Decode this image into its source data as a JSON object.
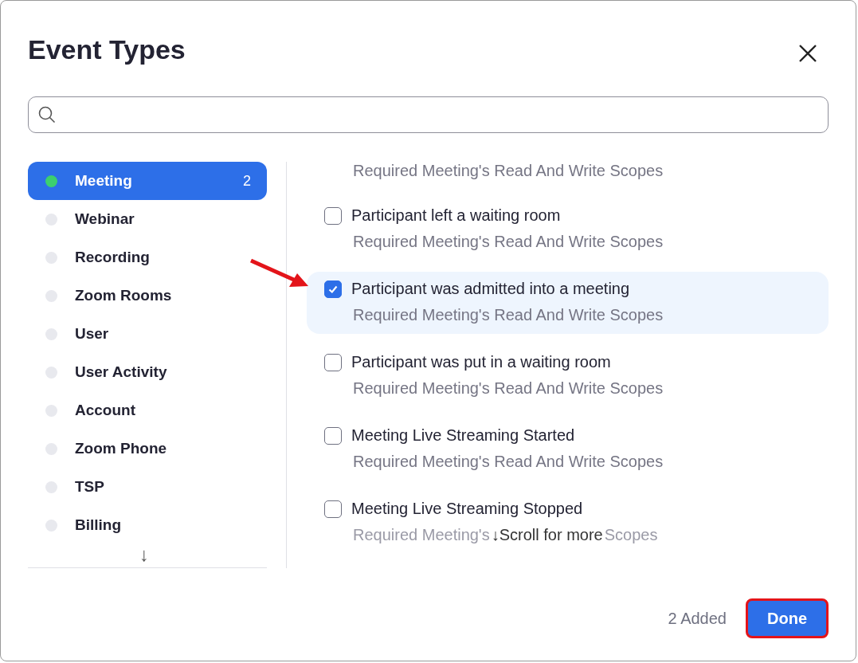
{
  "dialog": {
    "title": "Event Types"
  },
  "sidebar": {
    "items": [
      {
        "label": "Meeting",
        "selected": true,
        "count": "2",
        "color": "#3ccf6e"
      },
      {
        "label": "Webinar",
        "selected": false
      },
      {
        "label": "Recording",
        "selected": false
      },
      {
        "label": "Zoom Rooms",
        "selected": false
      },
      {
        "label": "User",
        "selected": false
      },
      {
        "label": "User Activity",
        "selected": false
      },
      {
        "label": "Account",
        "selected": false
      },
      {
        "label": "Zoom Phone",
        "selected": false
      },
      {
        "label": "TSP",
        "selected": false
      },
      {
        "label": "Billing",
        "selected": false
      }
    ],
    "scroll_arrow": "↓"
  },
  "events": [
    {
      "kind": "cut",
      "scope": "Required Meeting's Read And Write Scopes"
    },
    {
      "kind": "event",
      "label": "Participant left a waiting room",
      "scope": "Required Meeting's Read And Write Scopes",
      "checked": false
    },
    {
      "kind": "event",
      "label": "Participant was admitted into a meeting",
      "scope": "Required Meeting's Read And Write Scopes",
      "checked": true
    },
    {
      "kind": "event",
      "label": "Participant was put in a waiting room",
      "scope": "Required Meeting's Read And Write Scopes",
      "checked": false
    },
    {
      "kind": "event",
      "label": "Meeting Live Streaming Started",
      "scope": "Required Meeting's Read And Write Scopes",
      "checked": false
    },
    {
      "kind": "event",
      "label": "Meeting Live Streaming Stopped",
      "scope": "Required Meeting's",
      "scope_tail": "Scopes",
      "checked": false
    }
  ],
  "scroll_hint": "↓Scroll for more",
  "footer": {
    "added": "2 Added",
    "done": "Done",
    "done_highlighted": true
  }
}
